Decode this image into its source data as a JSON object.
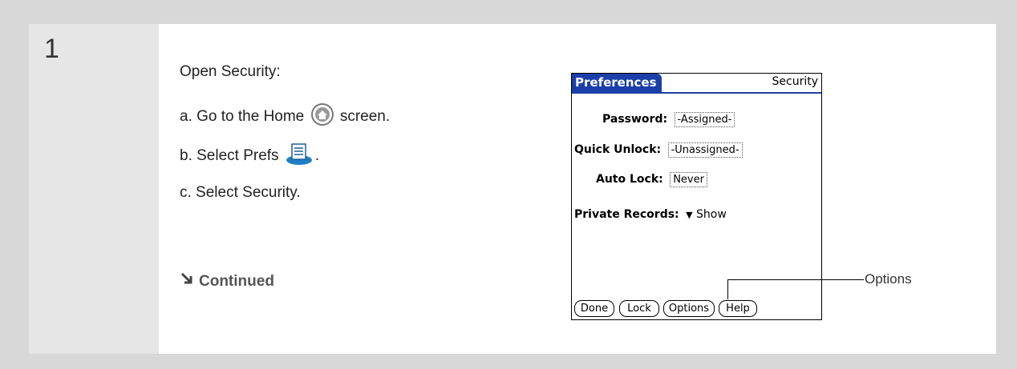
{
  "step": {
    "number": "1"
  },
  "instructions": {
    "heading": "Open Security:",
    "a_prefix": "a.  Go to the Home",
    "a_suffix": "screen.",
    "b_prefix": "b.  Select Prefs",
    "b_suffix": ".",
    "c": "c.  Select Security.",
    "continued": "Continued"
  },
  "palm": {
    "title": "Preferences",
    "section": "Security",
    "password_label": "Password:",
    "password_value": "-Assigned-",
    "quick_unlock_label": "Quick Unlock:",
    "quick_unlock_value": "-Unassigned-",
    "auto_lock_label": "Auto Lock:",
    "auto_lock_value": "Never",
    "private_records_label": "Private Records:",
    "private_records_value": "Show",
    "buttons": {
      "done": "Done",
      "lock": "Lock",
      "options": "Options",
      "help": "Help"
    }
  },
  "callout": {
    "label": "Options"
  },
  "colors": {
    "title_bar": "#1a3fa8",
    "background": "#d8d8d8",
    "panel": "#ffffff"
  }
}
